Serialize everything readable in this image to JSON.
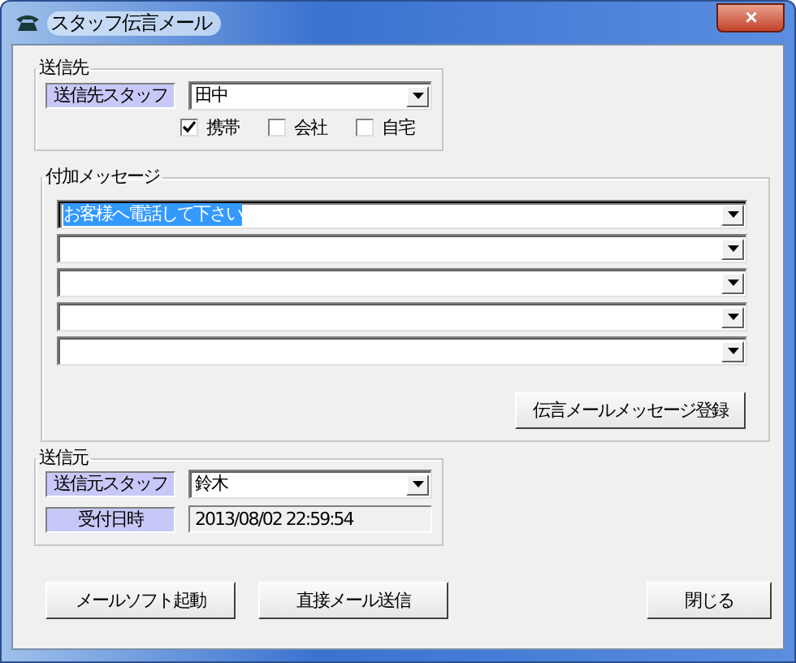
{
  "window": {
    "title": "スタッフ伝言メール",
    "close": "×"
  },
  "recipient": {
    "title": "送信先",
    "staff_label": "送信先スタッフ",
    "staff": "田中",
    "destinations": [
      {
        "label": "携帯",
        "checked": true
      },
      {
        "label": "会社",
        "checked": false
      },
      {
        "label": "自宅",
        "checked": false
      }
    ]
  },
  "messages": {
    "title": "付加メッセージ",
    "rows": [
      {
        "kind": "text",
        "value": "お客様へ電話して下さい",
        "selected": true
      },
      {
        "kind": "empty"
      },
      {
        "kind": "empty"
      },
      {
        "kind": "empty"
      },
      {
        "kind": "empty"
      }
    ],
    "register_button": "伝言メールメッセージ登録"
  },
  "sender": {
    "title": "送信元",
    "staff_label": "送信元スタッフ",
    "staff": "鈴木",
    "date_label": "受付日時",
    "date": "2013/08/02 22:59:54"
  },
  "buttons": [
    {
      "label": "メールソフト起動",
      "kind": "left"
    },
    {
      "label": "直接メール送信",
      "kind": "left"
    },
    {
      "label": "閉じる",
      "kind": "right"
    }
  ]
}
